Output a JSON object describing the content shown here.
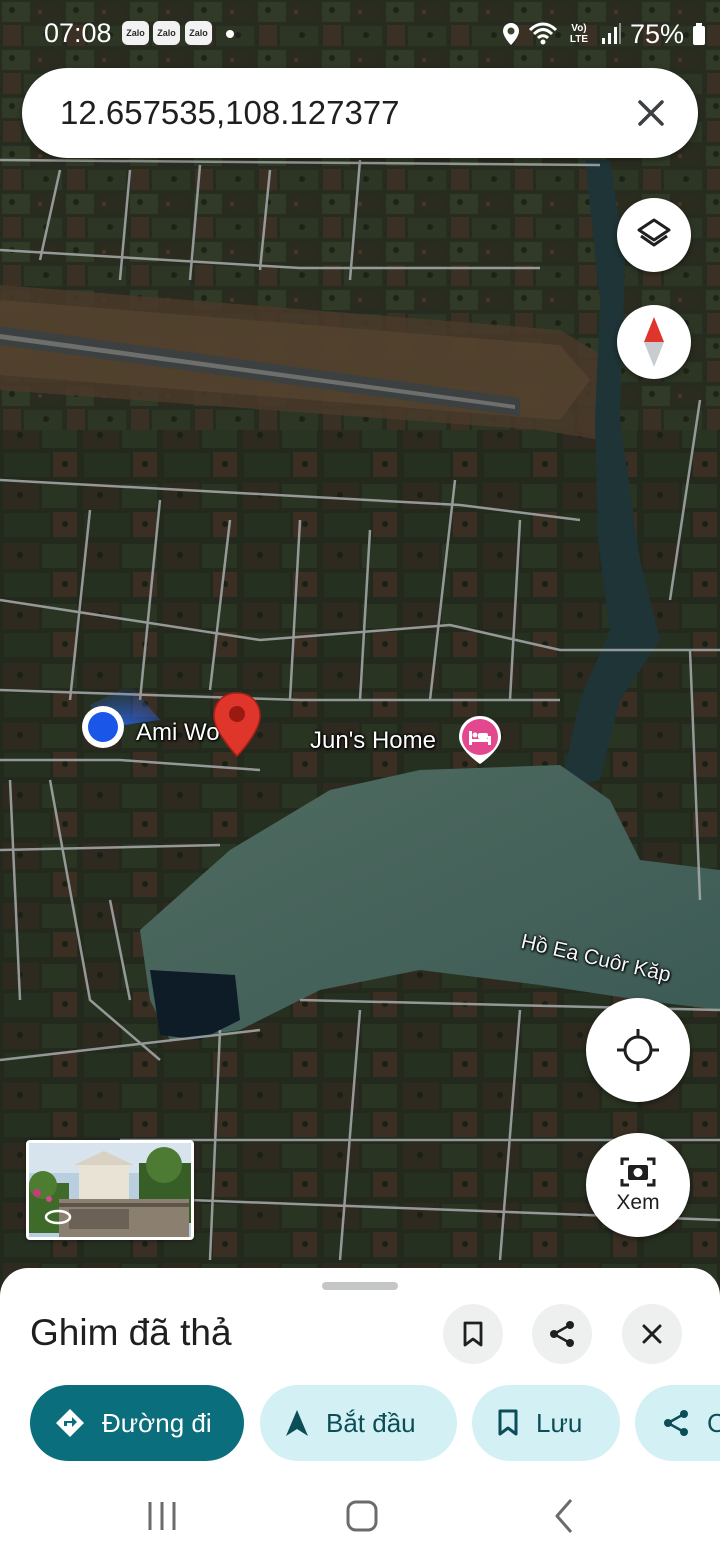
{
  "status_bar": {
    "time": "07:08",
    "notification_apps": [
      "Zalo",
      "Zalo",
      "Zalo"
    ],
    "network_label": "Vo) LTE",
    "battery": "75%",
    "icons": [
      "location-icon",
      "wifi-icon",
      "signal-icon",
      "battery-icon"
    ]
  },
  "search": {
    "query": "12.657535,108.127377",
    "clear_icon": "close-icon"
  },
  "map": {
    "type": "satellite",
    "labels": {
      "user_place": "Ami Wo",
      "hotel": "Jun's Home",
      "lake": "Hồ Ea Cuôr Kăp"
    },
    "pin_color": "#e0352b",
    "user_dot_color": "#1a57e8",
    "hotel_pin_color": "#e3488f"
  },
  "map_controls": {
    "layers_icon": "layers-icon",
    "compass_icon": "compass-icon",
    "my_location_icon": "my-location-icon",
    "view_label": "Xem",
    "view_icon": "street-view-camera-icon"
  },
  "sheet": {
    "title": "Ghim đã thả",
    "icons": [
      "bookmark-icon",
      "share-icon",
      "close-icon"
    ],
    "chips": [
      {
        "label": "Đường đi",
        "icon": "directions-icon"
      },
      {
        "label": "Bắt đầu",
        "icon": "navigation-icon"
      },
      {
        "label": "Lưu",
        "icon": "bookmark-icon"
      },
      {
        "label": "C",
        "icon": "share-icon"
      }
    ]
  },
  "colors": {
    "primary_chip": "#0b6e7c",
    "secondary_chip": "#d3f0f5"
  }
}
